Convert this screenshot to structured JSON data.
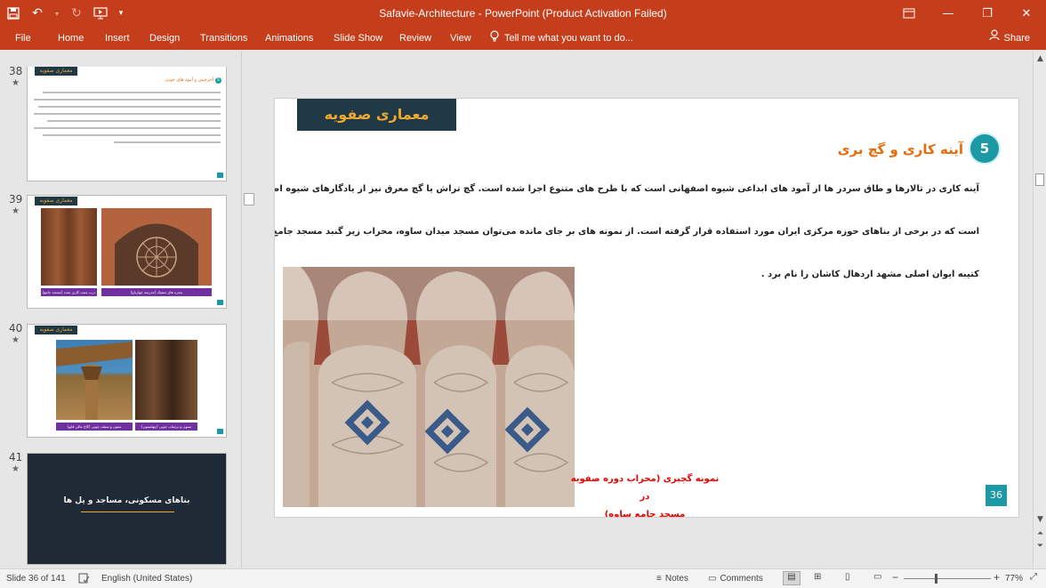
{
  "window": {
    "title": "Safavie-Architecture - PowerPoint (Product Activation Failed)",
    "icons": [
      "save-icon",
      "undo-icon",
      "redo-icon",
      "present-from-start-icon",
      "customize-qat-icon"
    ],
    "controls": [
      "ribbon-display-icon",
      "minimize-icon",
      "maximize-icon",
      "close-icon"
    ]
  },
  "ribbon": {
    "tabs": [
      "File",
      "Home",
      "Insert",
      "Design",
      "Transitions",
      "Animations",
      "Slide Show",
      "Review",
      "View"
    ],
    "tell_me": "Tell me what you want to do...",
    "share": "Share"
  },
  "thumbnails": [
    {
      "number": "38",
      "star": "★",
      "title": "معماری صفویه",
      "section": "آجرچینی و آمود های چوبی",
      "badge": "5"
    },
    {
      "number": "39",
      "star": "★",
      "title": "معماری صفویه",
      "captions": [
        "درب منبت کاری شده (مسجد جامع)",
        "پنجره های مشبک (مدرسه چهارباغ)"
      ]
    },
    {
      "number": "40",
      "star": "★",
      "title": "معماری صفویه",
      "captions": [
        "ستون و سقف چوبی (کاخ عالی قاپو)",
        "ستون و تزئینات چوبی (چهلستون)"
      ]
    },
    {
      "number": "41",
      "star": "★",
      "title": "بناهای مسکونی، مساجد و پل ها"
    }
  ],
  "slide": {
    "title": "معماری صفویه",
    "section_number": "5",
    "section_title": "آینه کاری و گچ بری",
    "paragraph_lines": [
      "آینه کاری در تالارها و طاق سردر ها از آمود های ابداعی شیوه اصفهانی است که با طرح های متنوع اجرا شده است. گچ تراش یا گچ معرق نیز از یادگارهای شیوه اصفهانی",
      "است که در برخی از بناهای حوزه مرکزی ایران مورد استفاده قرار گرفته است. از نمونه های بر جای مانده می‌توان مسجد میدان ساوه، محراب زیر گنبد مسجد جامع ساوه و",
      "کتیبه ایوان اصلی مشهد اردهال کاشان را نام برد ."
    ],
    "caption_lines": [
      "نمونه گچبری (محراب دوره صفویه در",
      "مسجد جامع ساوه)"
    ],
    "page_number": "36",
    "colors": {
      "title_bg": "#1f3a45",
      "title_text": "#f0a830",
      "accent": "#1b9aa5",
      "heading": "#e46c0a",
      "caption": "#e00000"
    }
  },
  "statusbar": {
    "slide_info": "Slide 36 of 141",
    "language": "English (United States)",
    "notes": "Notes",
    "comments": "Comments",
    "zoom": "77%",
    "zoom_value": 0.77
  }
}
